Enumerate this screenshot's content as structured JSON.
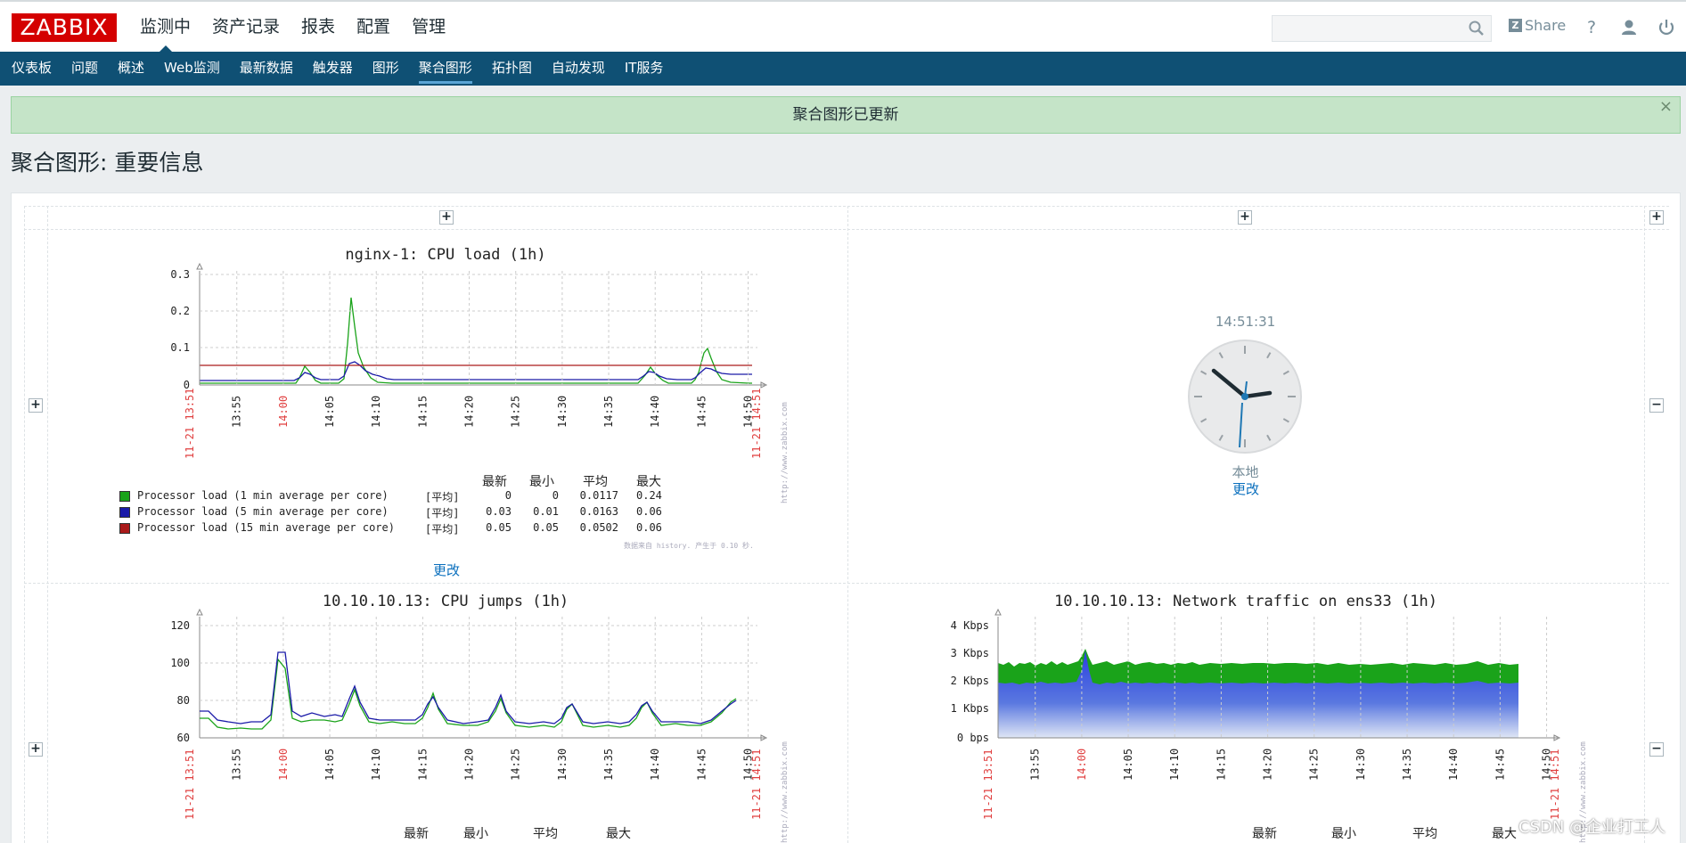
{
  "header": {
    "logo": "ZABBIX",
    "menu": [
      "监测中",
      "资产记录",
      "报表",
      "配置",
      "管理"
    ],
    "share_label": "Share",
    "help_symbol": "?",
    "icons": [
      "search-icon",
      "help-icon",
      "user-icon",
      "power-icon"
    ]
  },
  "subnav": [
    "仪表板",
    "问题",
    "概述",
    "Web监测",
    "最新数据",
    "触发器",
    "图形",
    "聚合图形",
    "拓扑图",
    "自动发现",
    "IT服务"
  ],
  "message": {
    "text": "聚合图形已更新",
    "close": "×"
  },
  "page": {
    "title": "聚合图形: 重要信息"
  },
  "screen": {
    "change_label": "更改",
    "legend_headers": [
      "最新",
      "最小",
      "平均",
      "最大"
    ],
    "cpu_load": {
      "title": "nginx-1: CPU load (1h)",
      "y_ticks": [
        "0.3",
        "0.2",
        "0.1",
        "0"
      ],
      "x_start": "11-21 13:51",
      "x_end": "11-21 14:51",
      "x_ticks": [
        "13:55",
        "14:00",
        "14:05",
        "14:10",
        "14:15",
        "14:20",
        "14:25",
        "14:30",
        "14:35",
        "14:40",
        "14:45",
        "14:50"
      ],
      "url": "http://www.zabbix.com",
      "footer": "数据来自 history. 产生于 0.10 秒.",
      "legend": [
        {
          "name": "Processor load (1 min average per core)",
          "func": "[平均]",
          "last": "0",
          "min": "0",
          "avg": "0.0117",
          "max": "0.24",
          "color": "#1aa31a"
        },
        {
          "name": "Processor load (5 min average per core)",
          "func": "[平均]",
          "last": "0.03",
          "min": "0.01",
          "avg": "0.0163",
          "max": "0.06",
          "color": "#1a1aa8"
        },
        {
          "name": "Processor load (15 min average per core)",
          "func": "[平均]",
          "last": "0.05",
          "min": "0.05",
          "avg": "0.0502",
          "max": "0.06",
          "color": "#aa1a1a"
        }
      ]
    },
    "clock": {
      "time": "14:51:31",
      "label": "本地"
    },
    "cpu_jumps": {
      "title": "10.10.10.13: CPU jumps (1h)",
      "y_ticks": [
        "120",
        "100",
        "80",
        "60"
      ],
      "x_start": "11-21 13:51",
      "x_end": "11-21 14:51",
      "x_ticks": [
        "13:55",
        "14:00",
        "14:05",
        "14:10",
        "14:15",
        "14:20",
        "14:25",
        "14:30",
        "14:35",
        "14:40",
        "14:45",
        "14:50"
      ],
      "url": "http://www.zabbix.com"
    },
    "network": {
      "title": "10.10.10.13: Network traffic on ens33 (1h)",
      "y_ticks": [
        "4 Kbps",
        "3 Kbps",
        "2 Kbps",
        "1 Kbps",
        "0 bps"
      ],
      "x_start": "11-21 13:51",
      "x_end": "11-21 14:51",
      "x_ticks": [
        "13:55",
        "14:00",
        "14:05",
        "14:10",
        "14:15",
        "14:20",
        "14:25",
        "14:30",
        "14:35",
        "14:40",
        "14:45",
        "14:50"
      ],
      "url": "http://www.zabbix.com"
    }
  },
  "watermark": "CSDN @企业打工人"
}
